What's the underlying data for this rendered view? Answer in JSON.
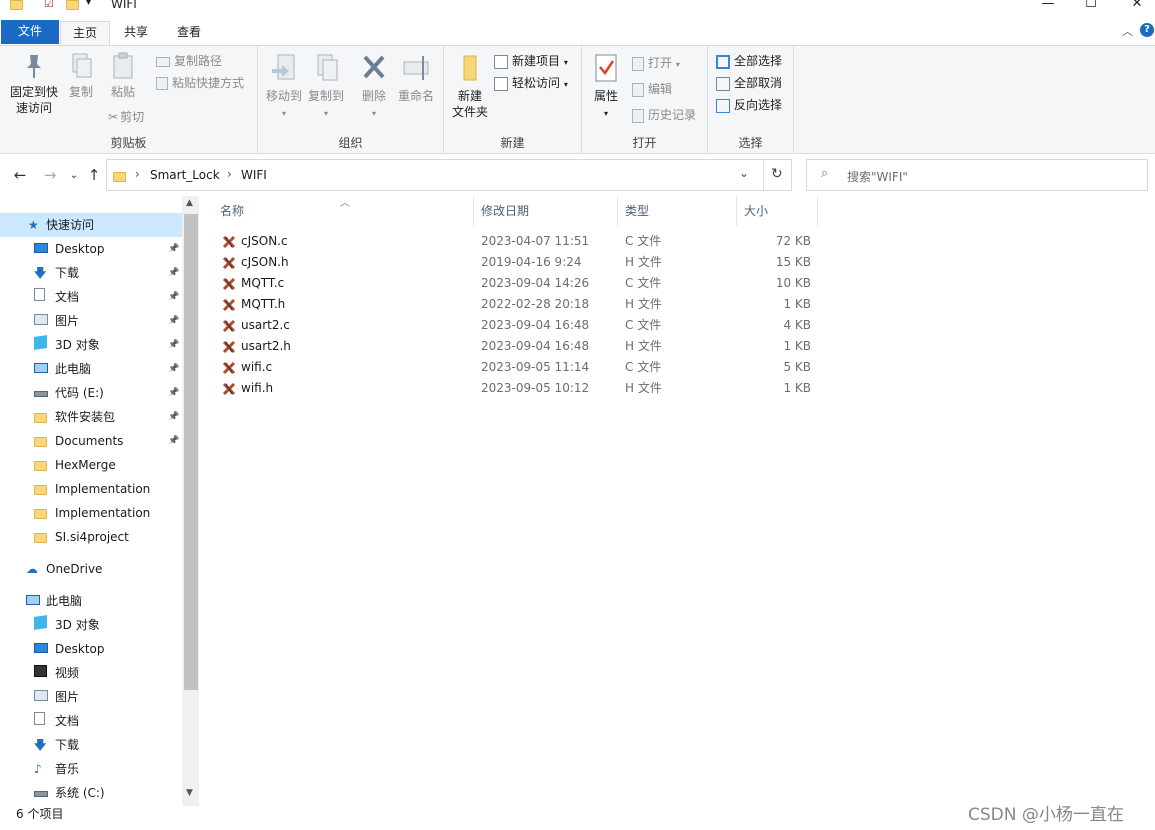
{
  "window": {
    "title": "WIFI",
    "controls": [
      "—",
      "☐",
      "✕"
    ]
  },
  "tabs": {
    "file": "文件",
    "home": "主页",
    "share": "共享",
    "view": "查看"
  },
  "ribbon": {
    "clipboard": {
      "label": "剪贴板",
      "pin_quick": "固定到快速访问",
      "pin_quick_l1": "固定到快",
      "pin_quick_l2": "速访问",
      "copy": "复制",
      "paste": "粘贴",
      "copy_path": "复制路径",
      "paste_shortcut": "粘贴快捷方式",
      "cut": "剪切"
    },
    "organize": {
      "label": "组织",
      "move_to": "移动到",
      "copy_to": "复制到",
      "delete": "删除",
      "rename": "重命名"
    },
    "new": {
      "label": "新建",
      "new_folder_l1": "新建",
      "new_folder_l2": "文件夹",
      "new_item": "新建项目",
      "easy_access": "轻松访问"
    },
    "open": {
      "label": "打开",
      "properties": "属性",
      "open": "打开",
      "edit": "编辑",
      "history": "历史记录"
    },
    "select": {
      "label": "选择",
      "select_all": "全部选择",
      "select_none": "全部取消",
      "invert": "反向选择"
    }
  },
  "address": {
    "crumbs": [
      "Smart_Lock",
      "WIFI"
    ],
    "search_placeholder": "搜索\"WIFI\""
  },
  "nav": {
    "quick_access": "快速访问",
    "quick_items": [
      {
        "label": "Desktop",
        "pinned": true
      },
      {
        "label": "下载",
        "pinned": true
      },
      {
        "label": "文档",
        "pinned": true
      },
      {
        "label": "图片",
        "pinned": true
      },
      {
        "label": "3D 对象",
        "pinned": true
      },
      {
        "label": "此电脑",
        "pinned": true
      },
      {
        "label": "代码 (E:)",
        "pinned": true
      },
      {
        "label": "软件安装包",
        "pinned": true
      },
      {
        "label": "Documents",
        "pinned": true
      },
      {
        "label": "HexMerge",
        "pinned": false
      },
      {
        "label": "Implementation",
        "pinned": false
      },
      {
        "label": "Implementation",
        "pinned": false
      },
      {
        "label": "SI.si4project",
        "pinned": false
      }
    ],
    "onedrive": "OneDrive",
    "this_pc": "此电脑",
    "pc_items": [
      "3D 对象",
      "Desktop",
      "视频",
      "图片",
      "文档",
      "下载",
      "音乐",
      "系统 (C:)"
    ]
  },
  "columns": {
    "name": "名称",
    "modified": "修改日期",
    "type": "类型",
    "size": "大小"
  },
  "files": [
    {
      "name": "cJSON.c",
      "modified": "2023-04-07 11:51",
      "type": "C 文件",
      "size": "72 KB"
    },
    {
      "name": "cJSON.h",
      "modified": "2019-04-16 9:24",
      "type": "H 文件",
      "size": "15 KB"
    },
    {
      "name": "MQTT.c",
      "modified": "2023-09-04 14:26",
      "type": "C 文件",
      "size": "10 KB"
    },
    {
      "name": "MQTT.h",
      "modified": "2022-02-28 20:18",
      "type": "H 文件",
      "size": "1 KB"
    },
    {
      "name": "usart2.c",
      "modified": "2023-09-04 16:48",
      "type": "C 文件",
      "size": "4 KB"
    },
    {
      "name": "usart2.h",
      "modified": "2023-09-04 16:48",
      "type": "H 文件",
      "size": "1 KB"
    },
    {
      "name": "wifi.c",
      "modified": "2023-09-05 11:14",
      "type": "C 文件",
      "size": "5 KB"
    },
    {
      "name": "wifi.h",
      "modified": "2023-09-05 10:12",
      "type": "H 文件",
      "size": "1 KB"
    }
  ],
  "status": {
    "count": "6 个项目"
  },
  "watermark": "CSDN @小杨一直在",
  "colors": {
    "accent": "#1a6ac4",
    "selection": "#cce8ff",
    "ribbon_bg": "#f5f6f7"
  }
}
